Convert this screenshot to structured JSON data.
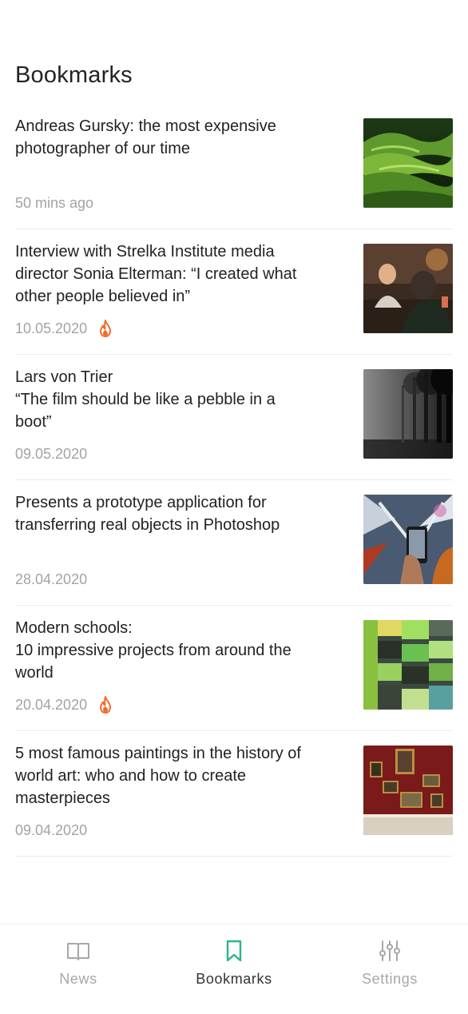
{
  "page": {
    "title": "Bookmarks"
  },
  "articles": [
    {
      "title": "Andreas Gursky: the most expensive\nphotographer of our time",
      "date": "50 mins ago",
      "hot": false,
      "image": "green-hills-photo"
    },
    {
      "title": "Interview with Strelka Institute media\ndirector Sonia Elterman: “I created what\nother people believed in”",
      "date": "10.05.2020",
      "hot": true,
      "image": "interview-photo"
    },
    {
      "title": "Lars von Trier\n“The film should be like a pebble in a\nboot”",
      "date": "09.05.2020",
      "hot": false,
      "image": "foggy-forest-photo"
    },
    {
      "title": "Presents a prototype application for\ntransferring real objects in Photoshop",
      "date": "28.04.2020",
      "hot": false,
      "image": "phone-photo"
    },
    {
      "title": "Modern schools:\n10 impressive projects from around the\nworld",
      "date": "20.04.2020",
      "hot": true,
      "image": "facade-photo"
    },
    {
      "title": "5 most famous paintings in the history of\nworld art: who and how to create\nmasterpieces",
      "date": "09.04.2020",
      "hot": false,
      "image": "gallery-photo"
    }
  ],
  "tabs": [
    {
      "label": "News",
      "icon": "book-icon",
      "active": false
    },
    {
      "label": "Bookmarks",
      "icon": "bookmark-icon",
      "active": true
    },
    {
      "label": "Settings",
      "icon": "sliders-icon",
      "active": false
    }
  ],
  "colors": {
    "accent": "#2bb58a",
    "hot": "#f26b2b",
    "muted": "#a3a3a3"
  }
}
